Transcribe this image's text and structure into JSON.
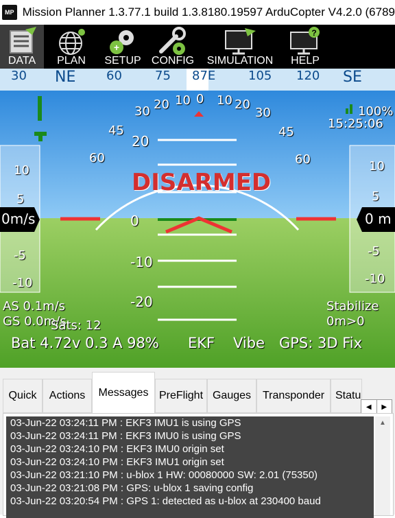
{
  "title": "Mission Planner 1.3.77.1 build 1.3.8180.19597 ArduCopter V4.2.0 (6789",
  "logo": "MP",
  "toolbar": [
    {
      "label": "DATA",
      "icon": "data-icon"
    },
    {
      "label": "PLAN",
      "icon": "globe-icon"
    },
    {
      "label": "SETUP",
      "icon": "gears-icon"
    },
    {
      "label": "CONFIG",
      "icon": "wrench-icon"
    },
    {
      "label": "SIMULATION",
      "icon": "monitor-plane-icon"
    },
    {
      "label": "HELP",
      "icon": "monitor-help-icon"
    }
  ],
  "hud": {
    "heading_labels": [
      "30",
      "NE",
      "60",
      "75",
      "87E",
      "105",
      "120",
      "SE"
    ],
    "roll_labels": [
      "60",
      "45",
      "30",
      "20",
      "10",
      "0",
      "10",
      "20",
      "30",
      "45",
      "60"
    ],
    "pitch_labels": [
      "20",
      "0",
      "-10",
      "-20"
    ],
    "status": "DISARMED",
    "battery_percent": "100%",
    "clock": "15:25:06",
    "left_speed_ticks": [
      "10",
      "5",
      "-5",
      "-10"
    ],
    "right_alt_ticks": [
      "10",
      "5",
      "-5",
      "-10"
    ],
    "left_speed": "0m/s",
    "right_alt": "0 m",
    "airspeed": "AS 0.1m/s",
    "groundspeed": "GS 0.0m/s",
    "sats": "Sats: 12",
    "mode": "Stabilize",
    "dist_home": "0m>0",
    "battery": "Bat 4.72v 0.3 A 98%",
    "ekf": "EKF",
    "vibe": "Vibe",
    "gps": "GPS: 3D Fix",
    "colors": {
      "sky": "#2a93e2",
      "ground": "#6bbf3a",
      "warning": "#d32f2f"
    }
  },
  "tabs": [
    "Quick",
    "Actions",
    "Messages",
    "PreFlight",
    "Gauges",
    "Transponder",
    "Status"
  ],
  "selected_tab": "Messages",
  "messages": [
    "03-Jun-22 03:24:11 PM : EKF3 IMU1 is using GPS",
    "03-Jun-22 03:24:11 PM : EKF3 IMU0 is using GPS",
    "03-Jun-22 03:24:10 PM : EKF3 IMU0 origin set",
    "03-Jun-22 03:24:10 PM : EKF3 IMU1 origin set",
    "03-Jun-22 03:21:10 PM : u-blox 1 HW: 00080000 SW: 2.01 (75350)",
    "03-Jun-22 03:21:08 PM : GPS: u-blox 1 saving config",
    "03-Jun-22 03:20:54 PM : GPS 1: detected as u-blox at 230400 baud"
  ]
}
